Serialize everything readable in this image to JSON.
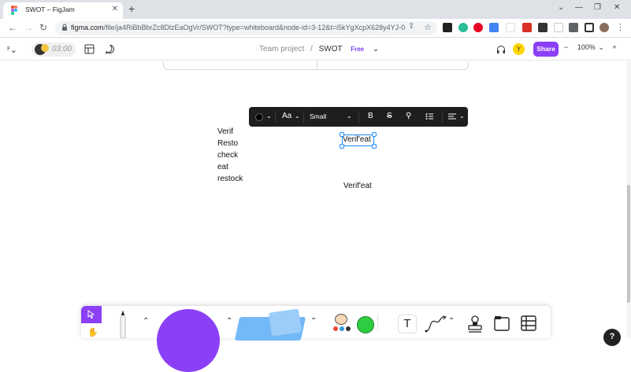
{
  "browser": {
    "tab_title": "SWOT – FigJam",
    "new_tab_label": "+",
    "url_host": "figma.com",
    "url_path": "/file/ja4RiBbBbrZc8DlzEaOgVr/SWOT?type=whiteboard&node-id=3-12&t=i5kYgXcpX628y4YJ-0"
  },
  "figjam": {
    "timer": "03:00",
    "breadcrumb_team": "Team project",
    "breadcrumb_separator": "/",
    "doc_title": "SWOT",
    "plan_badge": "Free",
    "avatar_initial": "Y",
    "share_label": "Share",
    "zoom_minus": "−",
    "zoom_level": "100%",
    "zoom_plus": "+"
  },
  "text_toolbar": {
    "font_label": "Aa",
    "size_label": "Small",
    "bold": "B",
    "strike": "S"
  },
  "canvas": {
    "list_lines": [
      "Verif",
      "Resto",
      "check",
      "eat",
      "restock"
    ],
    "selected_text": "Verif'eat",
    "plain_text": "Verif'eat"
  },
  "help_label": "?",
  "colors": {
    "accent": "#8b3ff6",
    "selection": "#1a8cff",
    "toolbar_dark": "#1e1e1e",
    "shape_purple": "#8b3ff6",
    "sticky_blue": "#74b9f7"
  }
}
